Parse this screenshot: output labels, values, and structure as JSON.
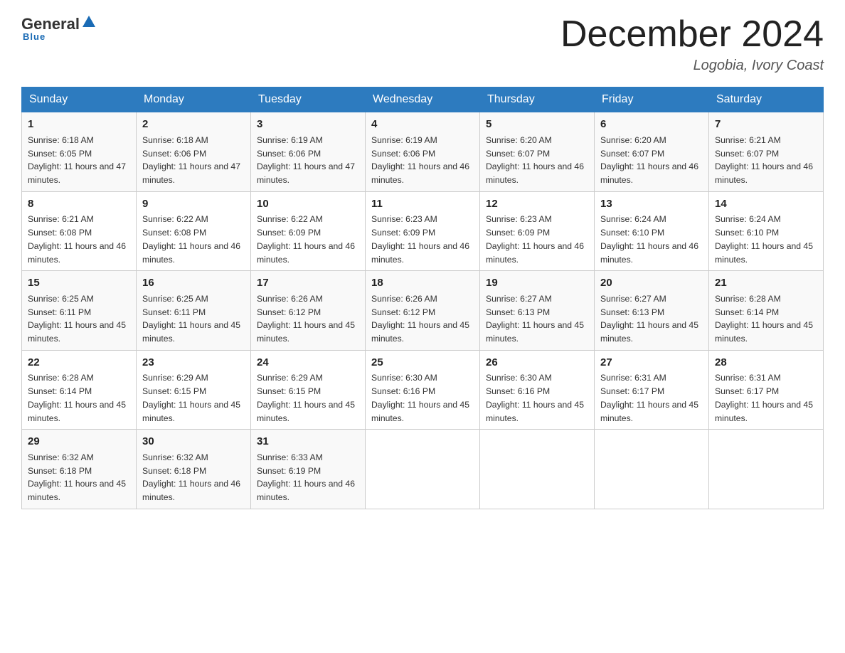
{
  "header": {
    "logo": {
      "general": "General",
      "blue": "Blue",
      "underline": "Blue"
    },
    "title": "December 2024",
    "location": "Logobia, Ivory Coast"
  },
  "days_of_week": [
    "Sunday",
    "Monday",
    "Tuesday",
    "Wednesday",
    "Thursday",
    "Friday",
    "Saturday"
  ],
  "weeks": [
    [
      {
        "day": "1",
        "sunrise": "6:18 AM",
        "sunset": "6:05 PM",
        "daylight": "11 hours and 47 minutes."
      },
      {
        "day": "2",
        "sunrise": "6:18 AM",
        "sunset": "6:06 PM",
        "daylight": "11 hours and 47 minutes."
      },
      {
        "day": "3",
        "sunrise": "6:19 AM",
        "sunset": "6:06 PM",
        "daylight": "11 hours and 47 minutes."
      },
      {
        "day": "4",
        "sunrise": "6:19 AM",
        "sunset": "6:06 PM",
        "daylight": "11 hours and 46 minutes."
      },
      {
        "day": "5",
        "sunrise": "6:20 AM",
        "sunset": "6:07 PM",
        "daylight": "11 hours and 46 minutes."
      },
      {
        "day": "6",
        "sunrise": "6:20 AM",
        "sunset": "6:07 PM",
        "daylight": "11 hours and 46 minutes."
      },
      {
        "day": "7",
        "sunrise": "6:21 AM",
        "sunset": "6:07 PM",
        "daylight": "11 hours and 46 minutes."
      }
    ],
    [
      {
        "day": "8",
        "sunrise": "6:21 AM",
        "sunset": "6:08 PM",
        "daylight": "11 hours and 46 minutes."
      },
      {
        "day": "9",
        "sunrise": "6:22 AM",
        "sunset": "6:08 PM",
        "daylight": "11 hours and 46 minutes."
      },
      {
        "day": "10",
        "sunrise": "6:22 AM",
        "sunset": "6:09 PM",
        "daylight": "11 hours and 46 minutes."
      },
      {
        "day": "11",
        "sunrise": "6:23 AM",
        "sunset": "6:09 PM",
        "daylight": "11 hours and 46 minutes."
      },
      {
        "day": "12",
        "sunrise": "6:23 AM",
        "sunset": "6:09 PM",
        "daylight": "11 hours and 46 minutes."
      },
      {
        "day": "13",
        "sunrise": "6:24 AM",
        "sunset": "6:10 PM",
        "daylight": "11 hours and 46 minutes."
      },
      {
        "day": "14",
        "sunrise": "6:24 AM",
        "sunset": "6:10 PM",
        "daylight": "11 hours and 45 minutes."
      }
    ],
    [
      {
        "day": "15",
        "sunrise": "6:25 AM",
        "sunset": "6:11 PM",
        "daylight": "11 hours and 45 minutes."
      },
      {
        "day": "16",
        "sunrise": "6:25 AM",
        "sunset": "6:11 PM",
        "daylight": "11 hours and 45 minutes."
      },
      {
        "day": "17",
        "sunrise": "6:26 AM",
        "sunset": "6:12 PM",
        "daylight": "11 hours and 45 minutes."
      },
      {
        "day": "18",
        "sunrise": "6:26 AM",
        "sunset": "6:12 PM",
        "daylight": "11 hours and 45 minutes."
      },
      {
        "day": "19",
        "sunrise": "6:27 AM",
        "sunset": "6:13 PM",
        "daylight": "11 hours and 45 minutes."
      },
      {
        "day": "20",
        "sunrise": "6:27 AM",
        "sunset": "6:13 PM",
        "daylight": "11 hours and 45 minutes."
      },
      {
        "day": "21",
        "sunrise": "6:28 AM",
        "sunset": "6:14 PM",
        "daylight": "11 hours and 45 minutes."
      }
    ],
    [
      {
        "day": "22",
        "sunrise": "6:28 AM",
        "sunset": "6:14 PM",
        "daylight": "11 hours and 45 minutes."
      },
      {
        "day": "23",
        "sunrise": "6:29 AM",
        "sunset": "6:15 PM",
        "daylight": "11 hours and 45 minutes."
      },
      {
        "day": "24",
        "sunrise": "6:29 AM",
        "sunset": "6:15 PM",
        "daylight": "11 hours and 45 minutes."
      },
      {
        "day": "25",
        "sunrise": "6:30 AM",
        "sunset": "6:16 PM",
        "daylight": "11 hours and 45 minutes."
      },
      {
        "day": "26",
        "sunrise": "6:30 AM",
        "sunset": "6:16 PM",
        "daylight": "11 hours and 45 minutes."
      },
      {
        "day": "27",
        "sunrise": "6:31 AM",
        "sunset": "6:17 PM",
        "daylight": "11 hours and 45 minutes."
      },
      {
        "day": "28",
        "sunrise": "6:31 AM",
        "sunset": "6:17 PM",
        "daylight": "11 hours and 45 minutes."
      }
    ],
    [
      {
        "day": "29",
        "sunrise": "6:32 AM",
        "sunset": "6:18 PM",
        "daylight": "11 hours and 45 minutes."
      },
      {
        "day": "30",
        "sunrise": "6:32 AM",
        "sunset": "6:18 PM",
        "daylight": "11 hours and 46 minutes."
      },
      {
        "day": "31",
        "sunrise": "6:33 AM",
        "sunset": "6:19 PM",
        "daylight": "11 hours and 46 minutes."
      },
      null,
      null,
      null,
      null
    ]
  ]
}
